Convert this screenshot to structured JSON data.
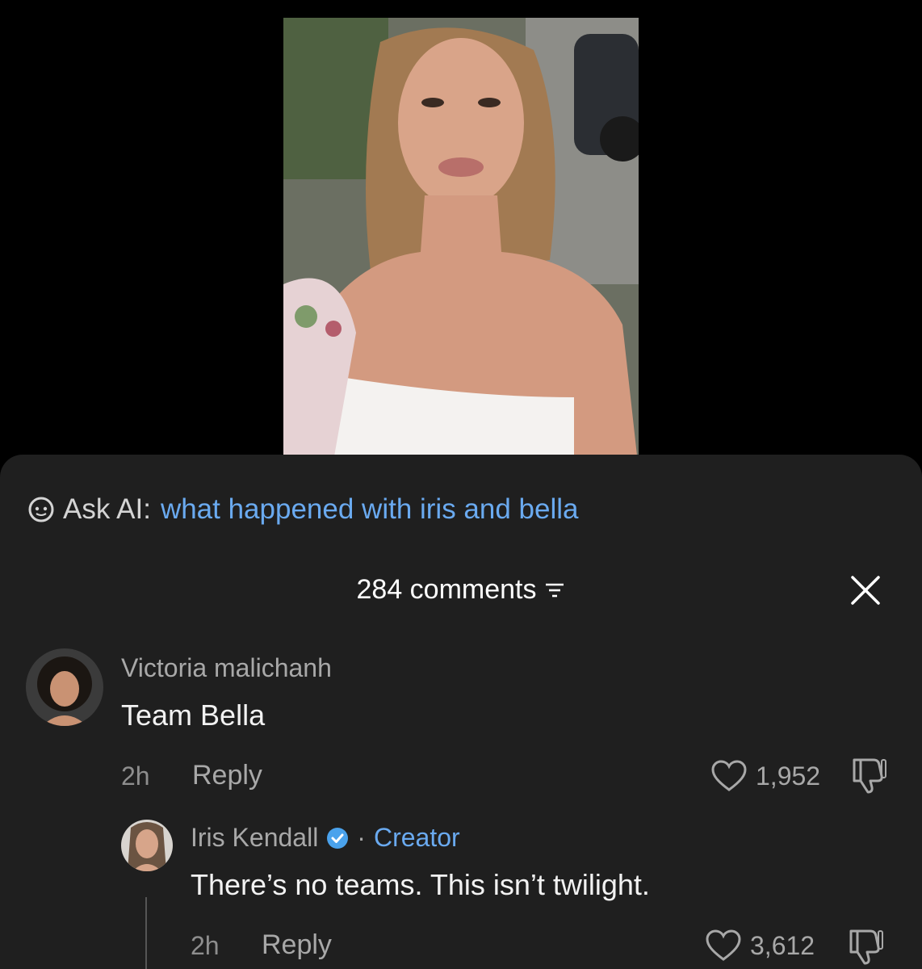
{
  "ask_ai": {
    "label": "Ask AI:",
    "query": "what happened with iris and bella"
  },
  "comments_header": {
    "count_label": "284 comments"
  },
  "comments": [
    {
      "author": "Victoria malichanh",
      "text": "Team Bella",
      "time": "2h",
      "reply_label": "Reply",
      "likes": "1,952"
    }
  ],
  "reply": {
    "author": "Iris Kendall",
    "separator": "·",
    "badge": "Creator",
    "text": "There’s no teams. This isn’t twilight.",
    "time": "2h",
    "reply_label": "Reply",
    "likes": "3,612"
  },
  "icons": {
    "ask_ai": "ai-chat-icon",
    "filter": "sort-filter-icon",
    "close": "close-icon",
    "like": "heart-icon",
    "dislike": "thumbs-down-icon",
    "verified": "verified-badge-icon"
  },
  "colors": {
    "sheet_bg": "#1f1f1f",
    "accent_blue": "#6aaaf0",
    "muted_text": "#a8a8a8"
  }
}
